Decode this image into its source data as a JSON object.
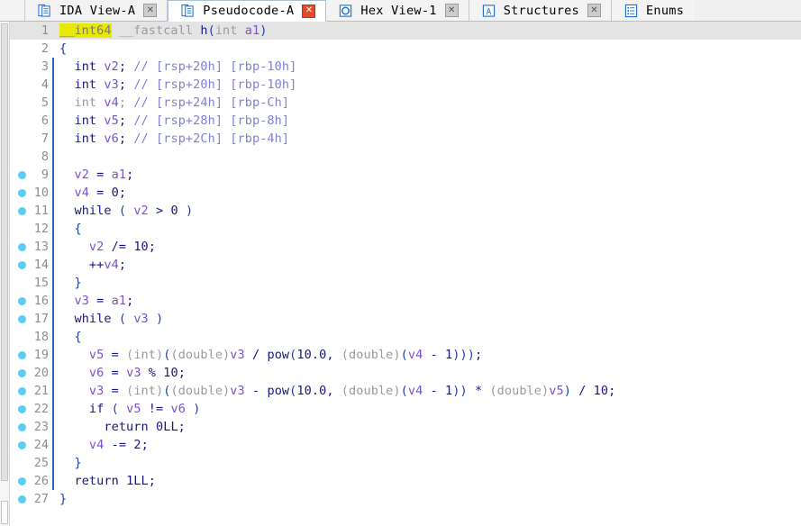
{
  "window": {
    "app": "IDA Pro",
    "active_view": "Pseudocode-A"
  },
  "tabs": [
    {
      "label": "IDA View-A",
      "icon": "document-icon",
      "close_label": "✕",
      "active": false
    },
    {
      "label": "Pseudocode-A",
      "icon": "document-icon",
      "close_label": "✕",
      "active": true
    },
    {
      "label": "Hex View-1",
      "icon": "hex-view-icon",
      "close_label": "✕",
      "active": false
    },
    {
      "label": "Structures",
      "icon": "structures-icon",
      "close_label": "✕",
      "active": false
    },
    {
      "label": "Enums",
      "icon": "enums-icon",
      "close_label": "",
      "active": false
    }
  ],
  "colors": {
    "keyword": "#16167a",
    "variable": "#7b4fcf",
    "comment": "#7f7fd5",
    "cast": "#9a9a9a",
    "punctuation": "#1a3ea8",
    "highlight": "#e8e800",
    "cursor_line": "#e4e4e4",
    "breakpoint": "#5ccdf2",
    "indent_guide": "#2b6cb8",
    "line_number": "#8d8d8d"
  },
  "code": {
    "language": "C pseudocode",
    "function_name": "h",
    "lines": [
      {
        "n": 1,
        "dot": false,
        "cursor": true,
        "guide": false,
        "text": "__int64 __fastcall h(int a1)"
      },
      {
        "n": 2,
        "dot": false,
        "cursor": false,
        "guide": false,
        "text": "{"
      },
      {
        "n": 3,
        "dot": false,
        "cursor": false,
        "guide": true,
        "text": "  int v2; // [rsp+20h] [rbp-10h]"
      },
      {
        "n": 4,
        "dot": false,
        "cursor": false,
        "guide": true,
        "text": "  int v3; // [rsp+20h] [rbp-10h]"
      },
      {
        "n": 5,
        "dot": false,
        "cursor": false,
        "guide": true,
        "text": "  int v4; // [rsp+24h] [rbp-Ch]"
      },
      {
        "n": 6,
        "dot": false,
        "cursor": false,
        "guide": true,
        "text": "  int v5; // [rsp+28h] [rbp-8h]"
      },
      {
        "n": 7,
        "dot": false,
        "cursor": false,
        "guide": true,
        "text": "  int v6; // [rsp+2Ch] [rbp-4h]"
      },
      {
        "n": 8,
        "dot": false,
        "cursor": false,
        "guide": true,
        "text": ""
      },
      {
        "n": 9,
        "dot": true,
        "cursor": false,
        "guide": true,
        "text": "  v2 = a1;"
      },
      {
        "n": 10,
        "dot": true,
        "cursor": false,
        "guide": true,
        "text": "  v4 = 0;"
      },
      {
        "n": 11,
        "dot": true,
        "cursor": false,
        "guide": true,
        "text": "  while ( v2 > 0 )"
      },
      {
        "n": 12,
        "dot": false,
        "cursor": false,
        "guide": true,
        "text": "  {"
      },
      {
        "n": 13,
        "dot": true,
        "cursor": false,
        "guide": true,
        "text": "    v2 /= 10;"
      },
      {
        "n": 14,
        "dot": true,
        "cursor": false,
        "guide": true,
        "text": "    ++v4;"
      },
      {
        "n": 15,
        "dot": false,
        "cursor": false,
        "guide": true,
        "text": "  }"
      },
      {
        "n": 16,
        "dot": true,
        "cursor": false,
        "guide": true,
        "text": "  v3 = a1;"
      },
      {
        "n": 17,
        "dot": true,
        "cursor": false,
        "guide": true,
        "text": "  while ( v3 )"
      },
      {
        "n": 18,
        "dot": false,
        "cursor": false,
        "guide": true,
        "text": "  {"
      },
      {
        "n": 19,
        "dot": true,
        "cursor": false,
        "guide": true,
        "text": "    v5 = (int)((double)v3 / pow(10.0, (double)(v4 - 1)));"
      },
      {
        "n": 20,
        "dot": true,
        "cursor": false,
        "guide": true,
        "text": "    v6 = v3 % 10;"
      },
      {
        "n": 21,
        "dot": true,
        "cursor": false,
        "guide": true,
        "text": "    v3 = (int)((double)v3 - pow(10.0, (double)(v4 - 1)) * (double)v5) / 10;"
      },
      {
        "n": 22,
        "dot": true,
        "cursor": false,
        "guide": true,
        "text": "    if ( v5 != v6 )"
      },
      {
        "n": 23,
        "dot": true,
        "cursor": false,
        "guide": true,
        "text": "      return 0LL;"
      },
      {
        "n": 24,
        "dot": true,
        "cursor": false,
        "guide": true,
        "text": "    v4 -= 2;"
      },
      {
        "n": 25,
        "dot": false,
        "cursor": false,
        "guide": true,
        "text": "  }"
      },
      {
        "n": 26,
        "dot": true,
        "cursor": false,
        "guide": true,
        "text": "  return 1LL;"
      },
      {
        "n": 27,
        "dot": true,
        "cursor": false,
        "guide": false,
        "text": "}"
      }
    ],
    "highlighted_token": "__int64",
    "dim_lines": [
      5
    ]
  }
}
